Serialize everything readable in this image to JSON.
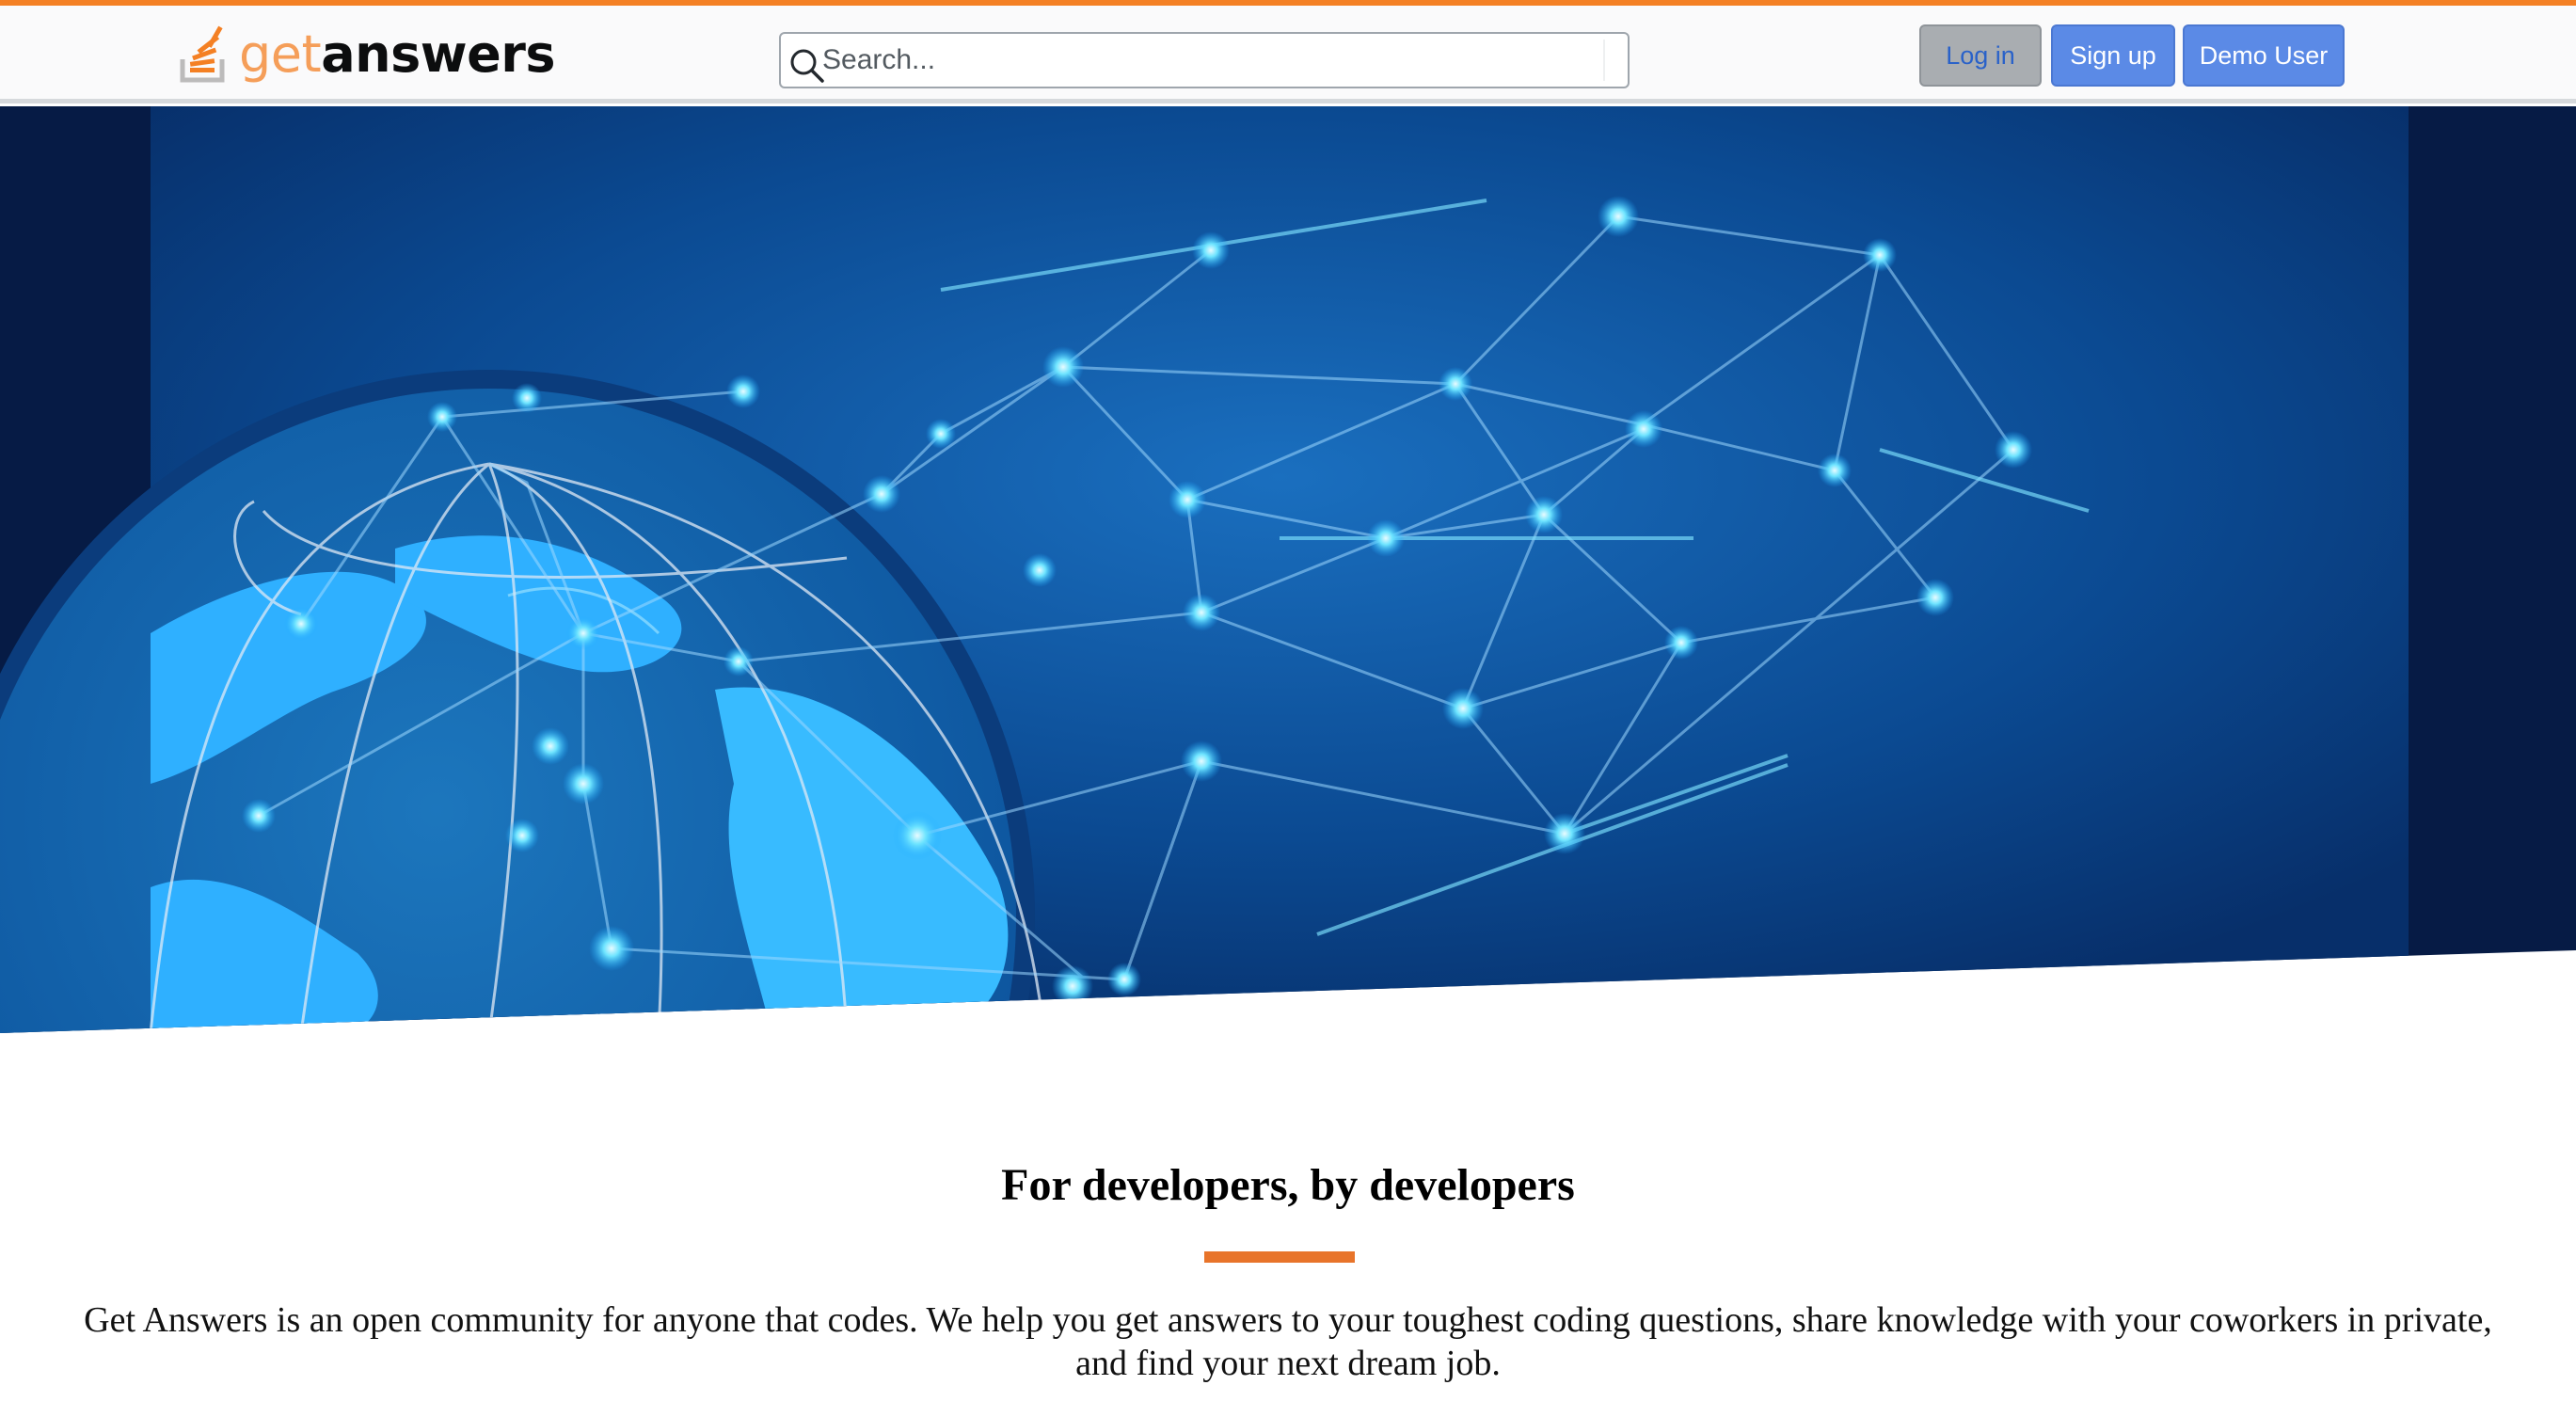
{
  "header": {
    "logo": {
      "prefix": "get",
      "name": "answers"
    },
    "search": {
      "placeholder": "Search...",
      "value": ""
    },
    "buttons": {
      "login": "Log in",
      "signup": "Sign up",
      "demo": "Demo User"
    }
  },
  "main": {
    "heading": "For developers, by developers",
    "description": "Get Answers is an open community for anyone that codes. We help you get answers to your toughest coding questions, share knowledge with your coworkers in private, and find your next dream job."
  },
  "colors": {
    "accent": "#f48024",
    "button_blue": "#5b8ae6",
    "button_gray": "#a9adb1",
    "hero_dark": "#061b45",
    "hero_blue": "#0d5fa8"
  },
  "icons": {
    "logo": "stack-logo-icon",
    "search": "search-icon"
  }
}
